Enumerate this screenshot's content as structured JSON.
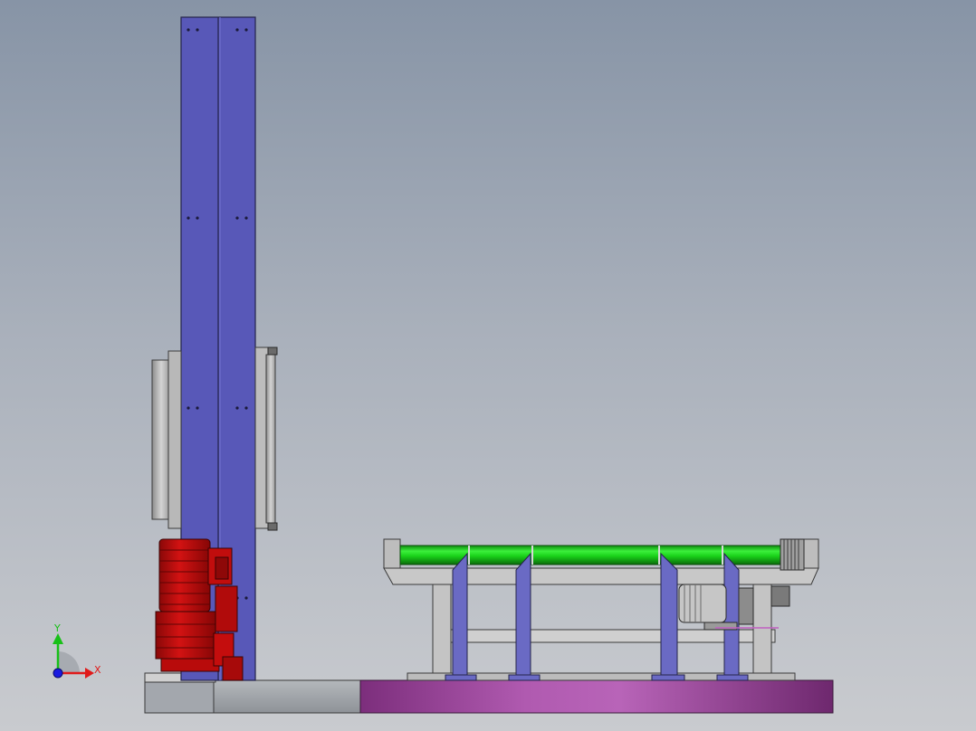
{
  "triad": {
    "x_label": "X",
    "y_label": "Y",
    "x_color": "#e01a1a",
    "y_color": "#18c018",
    "z_color": "#1a1ae0"
  },
  "colors": {
    "column_fill": "#5858b8",
    "column_edge": "#24244a",
    "motor_red": "#c40d0d",
    "motor_dark": "#7a0606",
    "roller_green": "#19d219",
    "roller_dark": "#0b7a0b",
    "turntable": "#b25ab2",
    "frame_grey": "#c8c8c8",
    "leg_blue": "#6a6ac4",
    "base_grey": "#9a9ea4"
  }
}
